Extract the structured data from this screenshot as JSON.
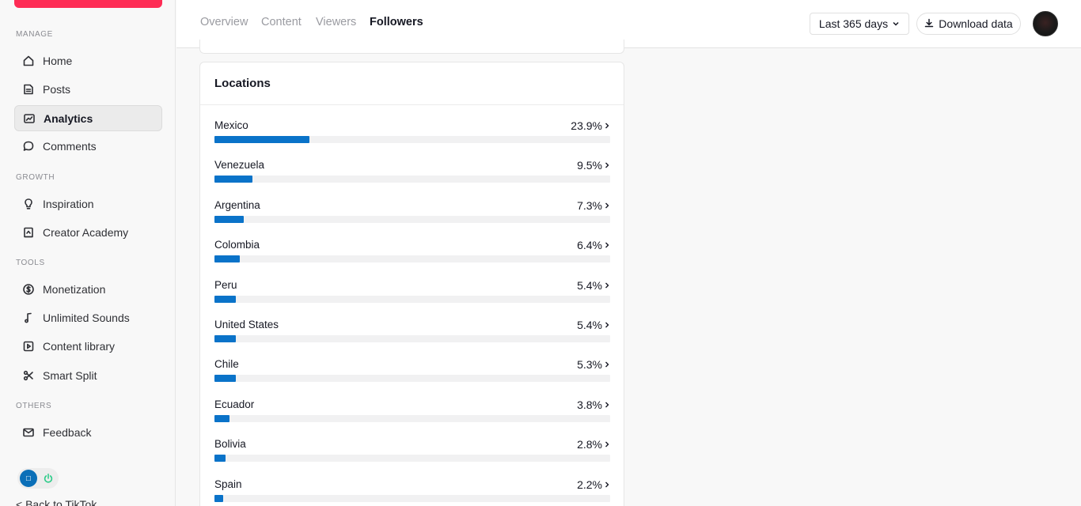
{
  "sidebar": {
    "sections": {
      "manage": "MANAGE",
      "growth": "GROWTH",
      "tools": "TOOLS",
      "others": "OTHERS"
    },
    "items": [
      {
        "label": "Home",
        "icon": "home-icon"
      },
      {
        "label": "Posts",
        "icon": "posts-icon"
      },
      {
        "label": "Analytics",
        "icon": "analytics-icon",
        "active": true
      },
      {
        "label": "Comments",
        "icon": "comments-icon"
      },
      {
        "label": "Inspiration",
        "icon": "bulb-icon"
      },
      {
        "label": "Creator Academy",
        "icon": "academy-icon"
      },
      {
        "label": "Monetization",
        "icon": "dollar-icon"
      },
      {
        "label": "Unlimited Sounds",
        "icon": "music-note-icon"
      },
      {
        "label": "Content library",
        "icon": "play-icon"
      },
      {
        "label": "Smart Split",
        "icon": "scissors-icon"
      },
      {
        "label": "Feedback",
        "icon": "mail-icon"
      }
    ],
    "back_link": "< Back to TikTok"
  },
  "header": {
    "tabs": [
      {
        "label": "Overview"
      },
      {
        "label": "Content"
      },
      {
        "label": "Viewers"
      },
      {
        "label": "Followers",
        "active": true
      }
    ],
    "range_label": "Last 365 days",
    "download_label": "Download data"
  },
  "locations": {
    "title": "Locations",
    "accent_color": "#0a73c9",
    "items": [
      {
        "name": "Mexico",
        "pct_label": "23.9%",
        "value": 23.9
      },
      {
        "name": "Venezuela",
        "pct_label": "9.5%",
        "value": 9.5
      },
      {
        "name": "Argentina",
        "pct_label": "7.3%",
        "value": 7.3
      },
      {
        "name": "Colombia",
        "pct_label": "6.4%",
        "value": 6.4
      },
      {
        "name": "Peru",
        "pct_label": "5.4%",
        "value": 5.4
      },
      {
        "name": "United States",
        "pct_label": "5.4%",
        "value": 5.4
      },
      {
        "name": "Chile",
        "pct_label": "5.3%",
        "value": 5.3
      },
      {
        "name": "Ecuador",
        "pct_label": "3.8%",
        "value": 3.8
      },
      {
        "name": "Bolivia",
        "pct_label": "2.8%",
        "value": 2.8
      },
      {
        "name": "Spain",
        "pct_label": "2.2%",
        "value": 2.2
      }
    ]
  }
}
